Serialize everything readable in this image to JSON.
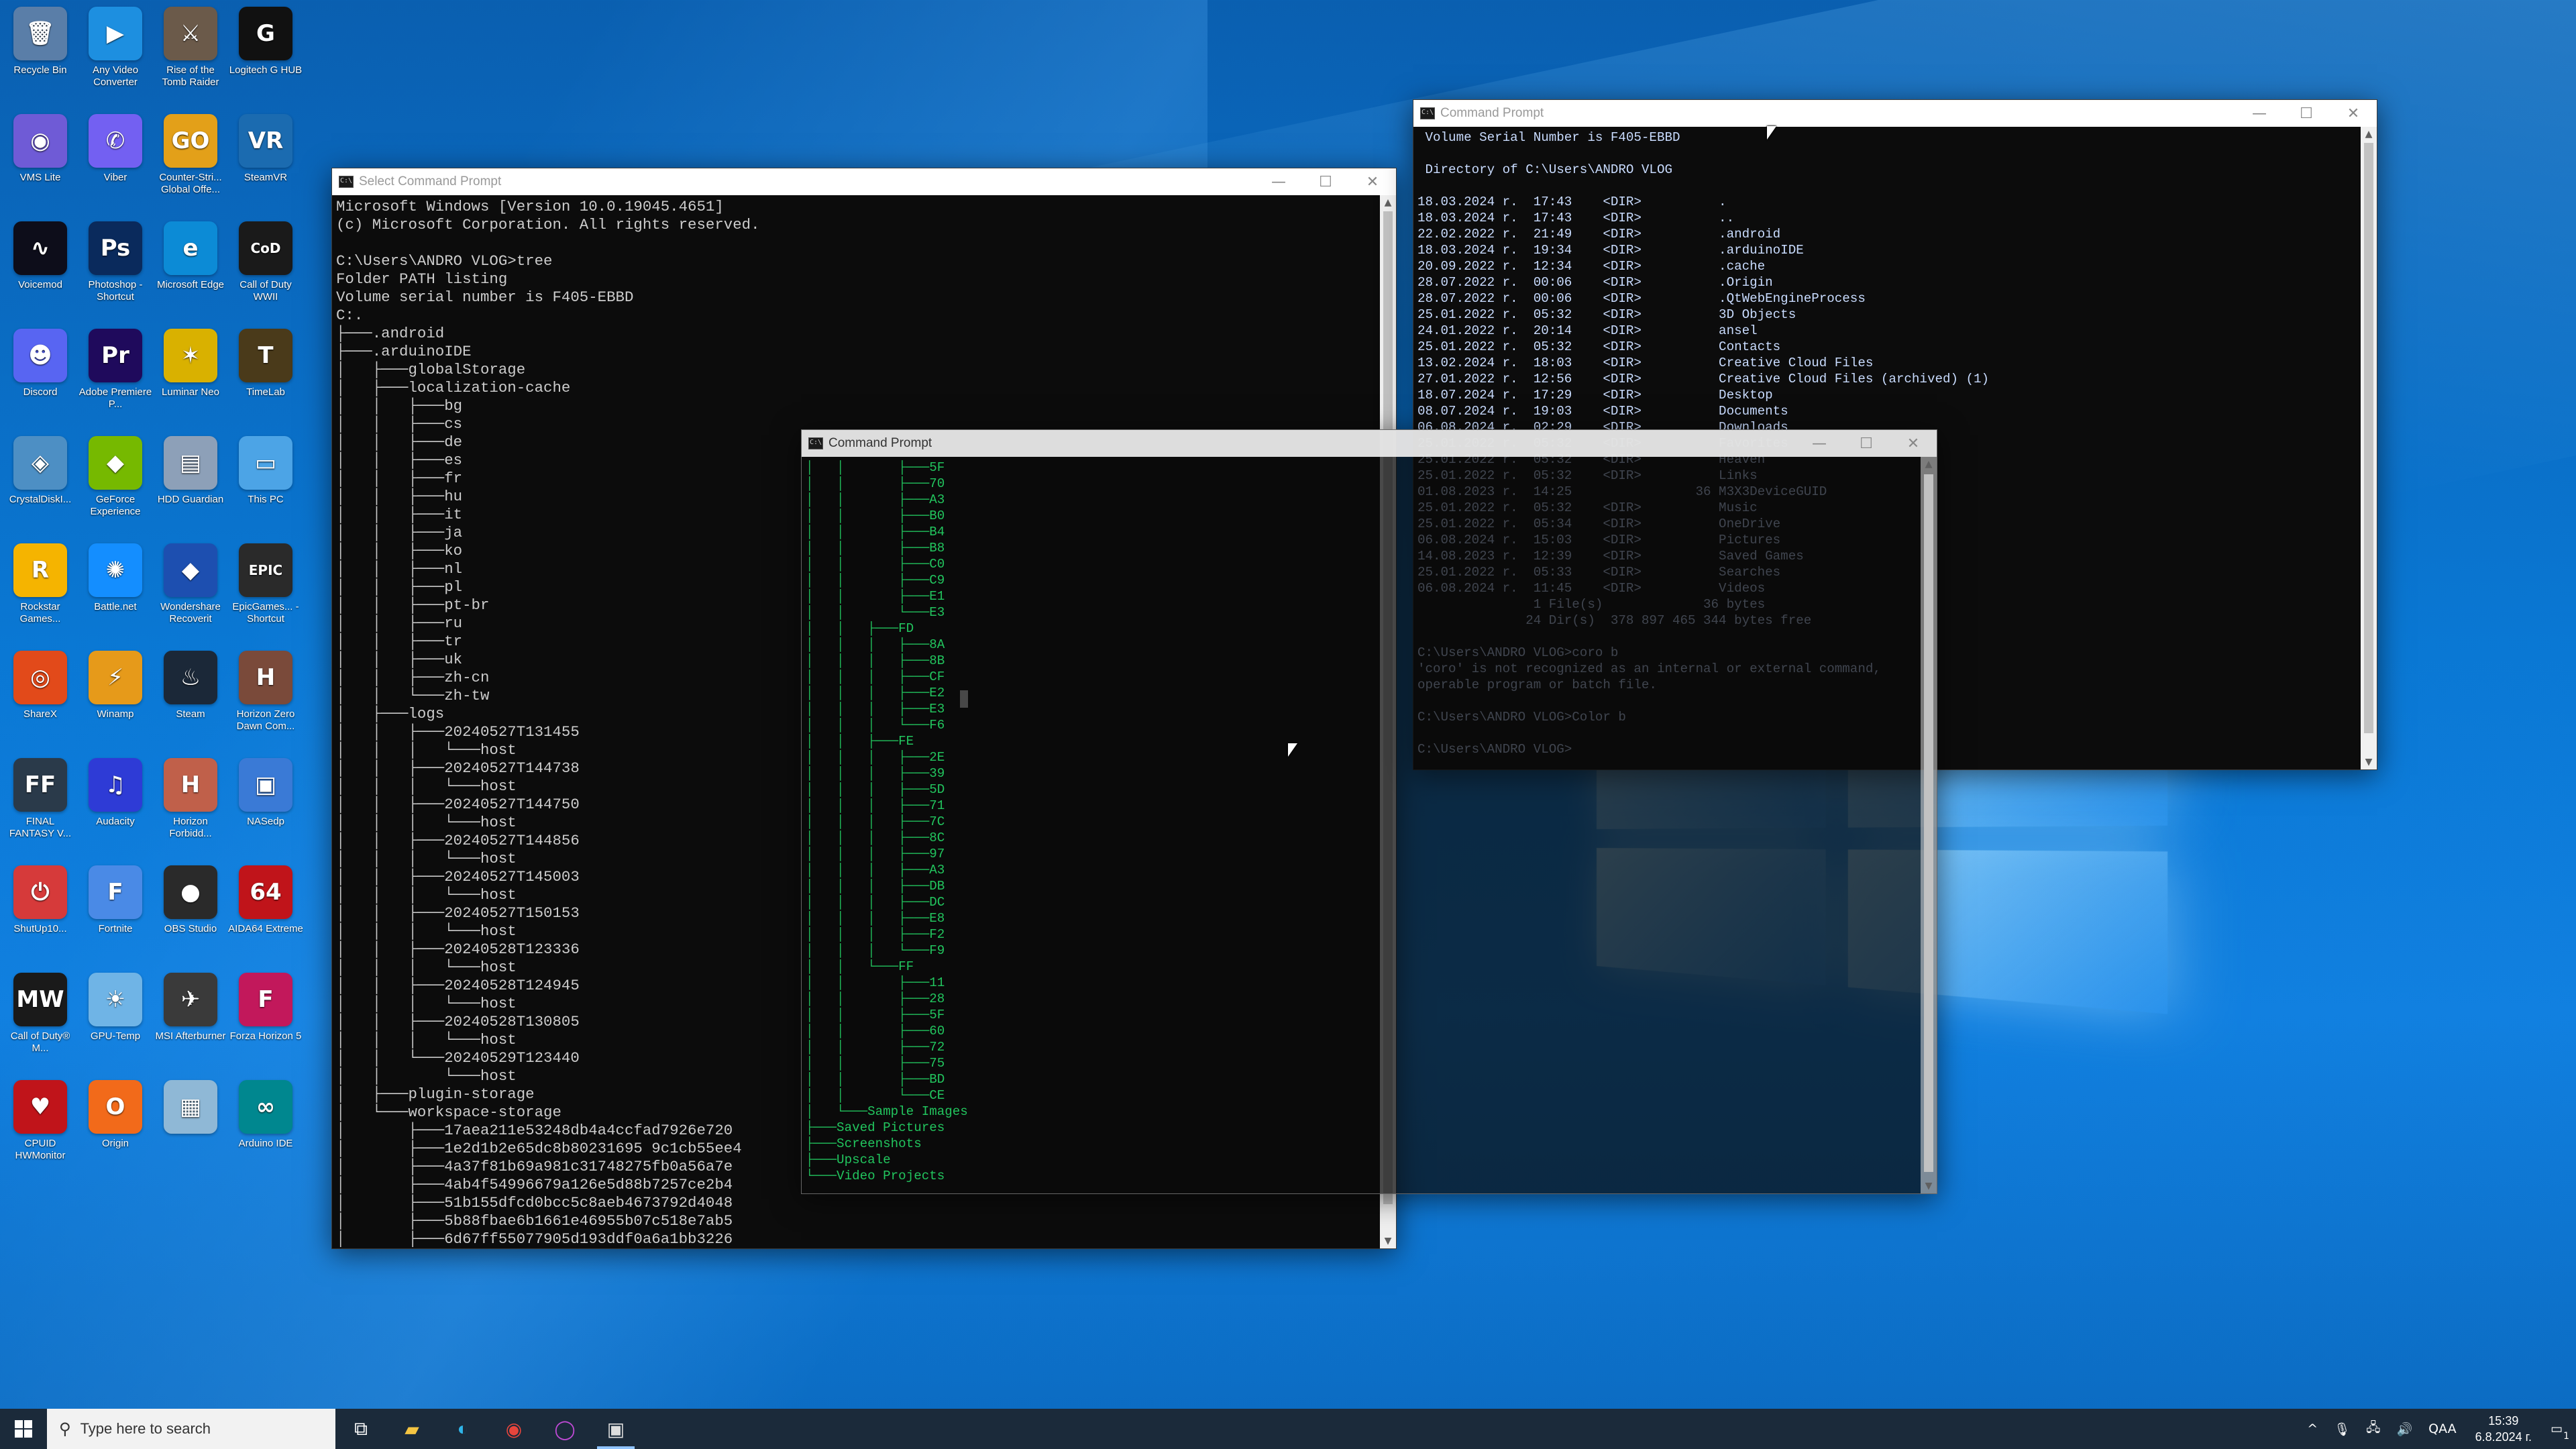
{
  "desktop": {
    "icons": [
      {
        "label": "Recycle Bin",
        "glyph": "🗑",
        "color": "#5a7ea8"
      },
      {
        "label": "Any Video Converter",
        "glyph": "▶",
        "color": "#1d8fe0"
      },
      {
        "label": "Rise of the Tomb Raider",
        "glyph": "⚔",
        "color": "#6b5a4a"
      },
      {
        "label": "Logitech G HUB",
        "glyph": "G",
        "color": "#111111"
      },
      {
        "label": "VMS Lite",
        "glyph": "◉",
        "color": "#6f5bd6"
      },
      {
        "label": "Viber",
        "glyph": "✆",
        "color": "#7360f2"
      },
      {
        "label": "Counter-Stri... Global Offe...",
        "glyph": "GO",
        "color": "#e3a019"
      },
      {
        "label": "SteamVR",
        "glyph": "VR",
        "color": "#1b6bb0"
      },
      {
        "label": "Voicemod",
        "glyph": "∿",
        "color": "#0d0d1a"
      },
      {
        "label": "Photoshop - Shortcut",
        "glyph": "Ps",
        "color": "#0a2a5c"
      },
      {
        "label": "Microsoft Edge",
        "glyph": "e",
        "color": "#0c8bd6"
      },
      {
        "label": "Call of Duty WWII",
        "glyph": "CoD",
        "color": "#1a1a1a"
      },
      {
        "label": "Discord",
        "glyph": "☻",
        "color": "#5865f2"
      },
      {
        "label": "Adobe Premiere P...",
        "glyph": "Pr",
        "color": "#1f0a5c"
      },
      {
        "label": "Luminar Neo",
        "glyph": "✶",
        "color": "#d9b100"
      },
      {
        "label": "TimeLab",
        "glyph": "T",
        "color": "#4a3a1a"
      },
      {
        "label": "CrystalDiskI...",
        "glyph": "◈",
        "color": "#4d8fc4"
      },
      {
        "label": "GeForce Experience",
        "glyph": "◆",
        "color": "#76b900"
      },
      {
        "label": "HDD Guardian",
        "glyph": "▤",
        "color": "#8da0b8"
      },
      {
        "label": "This PC",
        "glyph": "▭",
        "color": "#4ca4e6"
      },
      {
        "label": "Rockstar Games...",
        "glyph": "R",
        "color": "#f5b400"
      },
      {
        "label": "Battle.net",
        "glyph": "✺",
        "color": "#148eff"
      },
      {
        "label": "Wondershare Recoverit",
        "glyph": "◆",
        "color": "#1d4fb0"
      },
      {
        "label": "EpicGames... - Shortcut",
        "glyph": "EPIC",
        "color": "#2a2a2a"
      },
      {
        "label": "ShareX",
        "glyph": "◎",
        "color": "#e24a1a"
      },
      {
        "label": "Winamp",
        "glyph": "⚡",
        "color": "#e69a1a"
      },
      {
        "label": "Steam",
        "glyph": "♨",
        "color": "#1b2838"
      },
      {
        "label": "Horizon Zero Dawn Com...",
        "glyph": "H",
        "color": "#7a4a3a"
      },
      {
        "label": "FINAL FANTASY V...",
        "glyph": "FF",
        "color": "#2a3a4a"
      },
      {
        "label": "Audacity",
        "glyph": "♫",
        "color": "#2e3bd6"
      },
      {
        "label": "Horizon Forbidd...",
        "glyph": "H",
        "color": "#c0604a"
      },
      {
        "label": "NASedp",
        "glyph": "▣",
        "color": "#3a7ad6"
      },
      {
        "label": "ShutUp10...",
        "glyph": "⏻",
        "color": "#d63a3a"
      },
      {
        "label": "Fortnite",
        "glyph": "F",
        "color": "#4a8ae6"
      },
      {
        "label": "OBS Studio",
        "glyph": "●",
        "color": "#2a2a2a"
      },
      {
        "label": "AIDA64 Extreme",
        "glyph": "64",
        "color": "#c0141a"
      },
      {
        "label": "Call of Duty® M...",
        "glyph": "MW",
        "color": "#1a1a1a"
      },
      {
        "label": "GPU-Temp",
        "glyph": "☀",
        "color": "#6fb4e6"
      },
      {
        "label": "MSI Afterburner",
        "glyph": "✈",
        "color": "#3a3a3a"
      },
      {
        "label": "Forza Horizon 5",
        "glyph": "F",
        "color": "#c2185b"
      },
      {
        "label": "CPUID HWMonitor",
        "glyph": "♥",
        "color": "#c0141a"
      },
      {
        "label": "Origin",
        "glyph": "O",
        "color": "#f26a1a"
      },
      {
        "label": "",
        "glyph": "▦",
        "color": "#8fb8d6"
      },
      {
        "label": "Arduino IDE",
        "glyph": "∞",
        "color": "#00878f"
      }
    ]
  },
  "windows": {
    "w1": {
      "title": "Select Command Prompt",
      "content": "Microsoft Windows [Version 10.0.19045.4651]\n(c) Microsoft Corporation. All rights reserved.\n\nC:\\Users\\ANDRO VLOG>tree\nFolder PATH listing\nVolume serial number is F405-EBBD\nC:.\n├───.android\n├───.arduinoIDE\n│   ├───globalStorage\n│   ├───localization-cache\n│   │   ├───bg\n│   │   ├───cs\n│   │   ├───de\n│   │   ├───es\n│   │   ├───fr\n│   │   ├───hu\n│   │   ├───it\n│   │   ├───ja\n│   │   ├───ko\n│   │   ├───nl\n│   │   ├───pl\n│   │   ├───pt-br\n│   │   ├───ru\n│   │   ├───tr\n│   │   ├───uk\n│   │   ├───zh-cn\n│   │   └───zh-tw\n│   ├───logs\n│   │   ├───20240527T131455\n│   │   │   └───host\n│   │   ├───20240527T144738\n│   │   │   └───host\n│   │   ├───20240527T144750\n│   │   │   └───host\n│   │   ├───20240527T144856\n│   │   │   └───host\n│   │   ├───20240527T145003\n│   │   │   └───host\n│   │   ├───20240527T150153\n│   │   │   └───host\n│   │   ├───20240528T123336\n│   │   │   └───host\n│   │   ├───20240528T124945\n│   │   │   └───host\n│   │   ├───20240528T130805\n│   │   │   └───host\n│   │   └───20240529T123440\n│   │       └───host\n│   ├───plugin-storage\n│   └───workspace-storage\n│       ├───17aea211e53248db4a4ccfad7926e720\n│       ├───1e2d1b2e65dc8b80231695 9c1cb55ee4\n│       ├───4a37f81b69a981c31748275fb0a56a7e\n│       ├───4ab4f54996679a126e5d88b7257ce2b4\n│       ├───51b155dfcd0bcc5c8aeb4673792d4048\n│       ├───5b88fbae6b1661e46955b07c518e7ab5\n│       ├───6d67ff55077905d193ddf0a6a1bb3226"
    },
    "w2": {
      "title": "Command Prompt",
      "content": "│   │       ├───5F\n│   │       ├───70\n│   │       ├───A3\n│   │       ├───B0\n│   │       ├───B4\n│   │       ├───B8\n│   │       ├───C0\n│   │       ├───C9\n│   │       ├───E1\n│   │       └───E3\n│   │   ├───FD\n│   │   │   ├───8A\n│   │   │   ├───8B\n│   │   │   ├───CF\n│   │   │   ├───E2\n│   │   │   ├───E3\n│   │   │   └───F6\n│   │   ├───FE\n│   │   │   ├───2E\n│   │   │   ├───39\n│   │   │   ├───5D\n│   │   │   ├───71\n│   │   │   ├───7C\n│   │   │   ├───8C\n│   │   │   ├───97\n│   │   │   ├───A3\n│   │   │   ├───DB\n│   │   │   ├───DC\n│   │   │   ├───E8\n│   │   │   ├───F2\n│   │   │   └───F9\n│   │   └───FF\n│   │       ├───11\n│   │       ├───28\n│   │       ├───5F\n│   │       ├───60\n│   │       ├───72\n│   │       ├───75\n│   │       ├───BD\n│   │       └───CE\n│   └───Sample Images\n├───Saved Pictures\n├───Screenshots\n├───Upscale\n└───Video Projects"
    },
    "w3": {
      "title": "Command Prompt",
      "content": " Volume Serial Number is F405-EBBD\n\n Directory of C:\\Users\\ANDRO VLOG\n\n18.03.2024 r.  17:43    <DIR>          .\n18.03.2024 r.  17:43    <DIR>          ..\n22.02.2022 r.  21:49    <DIR>          .android\n18.03.2024 r.  19:34    <DIR>          .arduinoIDE\n20.09.2022 r.  12:34    <DIR>          .cache\n28.07.2022 r.  00:06    <DIR>          .Origin\n28.07.2022 r.  00:06    <DIR>          .QtWebEngineProcess\n25.01.2022 r.  05:32    <DIR>          3D Objects\n24.01.2022 r.  20:14    <DIR>          ansel\n25.01.2022 r.  05:32    <DIR>          Contacts\n13.02.2024 r.  18:03    <DIR>          Creative Cloud Files\n27.01.2022 r.  12:56    <DIR>          Creative Cloud Files (archived) (1)\n18.07.2024 r.  17:29    <DIR>          Desktop\n08.07.2024 r.  19:03    <DIR>          Documents\n06.08.2024 r.  02:29    <DIR>          Downloads\n25.01.2022 r.  05:32    <DIR>          Favorites\n25.01.2022 r.  05:32    <DIR>          Heaven\n25.01.2022 r.  05:32    <DIR>          Links\n01.08.2023 r.  14:25                36 M3X3DeviceGUID\n25.01.2022 r.  05:32    <DIR>          Music\n25.01.2022 r.  05:34    <DIR>          OneDrive\n06.08.2024 r.  15:03    <DIR>          Pictures\n14.08.2023 r.  12:39    <DIR>          Saved Games\n25.01.2022 r.  05:33    <DIR>          Searches\n06.08.2024 r.  11:45    <DIR>          Videos\n               1 File(s)             36 bytes\n              24 Dir(s)  378 897 465 344 bytes free\n\nC:\\Users\\ANDRO VLOG>coro b\n'coro' is not recognized as an internal or external command,\noperable program or batch file.\n\nC:\\Users\\ANDRO VLOG>Color b\n\nC:\\Users\\ANDRO VLOG>"
    },
    "controls": {
      "minimize": "—",
      "maximize": "☐",
      "close": "✕"
    }
  },
  "taskbar": {
    "search_placeholder": "Type here to search",
    "apps": [
      {
        "name": "task-view",
        "glyph": "⧉"
      },
      {
        "name": "file-explorer",
        "glyph": "▰"
      },
      {
        "name": "edge",
        "glyph": "◐"
      },
      {
        "name": "chrome",
        "glyph": "◉"
      },
      {
        "name": "opera",
        "glyph": "◯"
      },
      {
        "name": "command-prompt",
        "glyph": "▣"
      }
    ],
    "tray": {
      "chevron": "^",
      "mic": "🎙",
      "network": "🖧",
      "volume": "🔊",
      "lang": "QAA",
      "time": "15:39",
      "date": "6.8.2024 г.",
      "notification_count": "1"
    }
  }
}
